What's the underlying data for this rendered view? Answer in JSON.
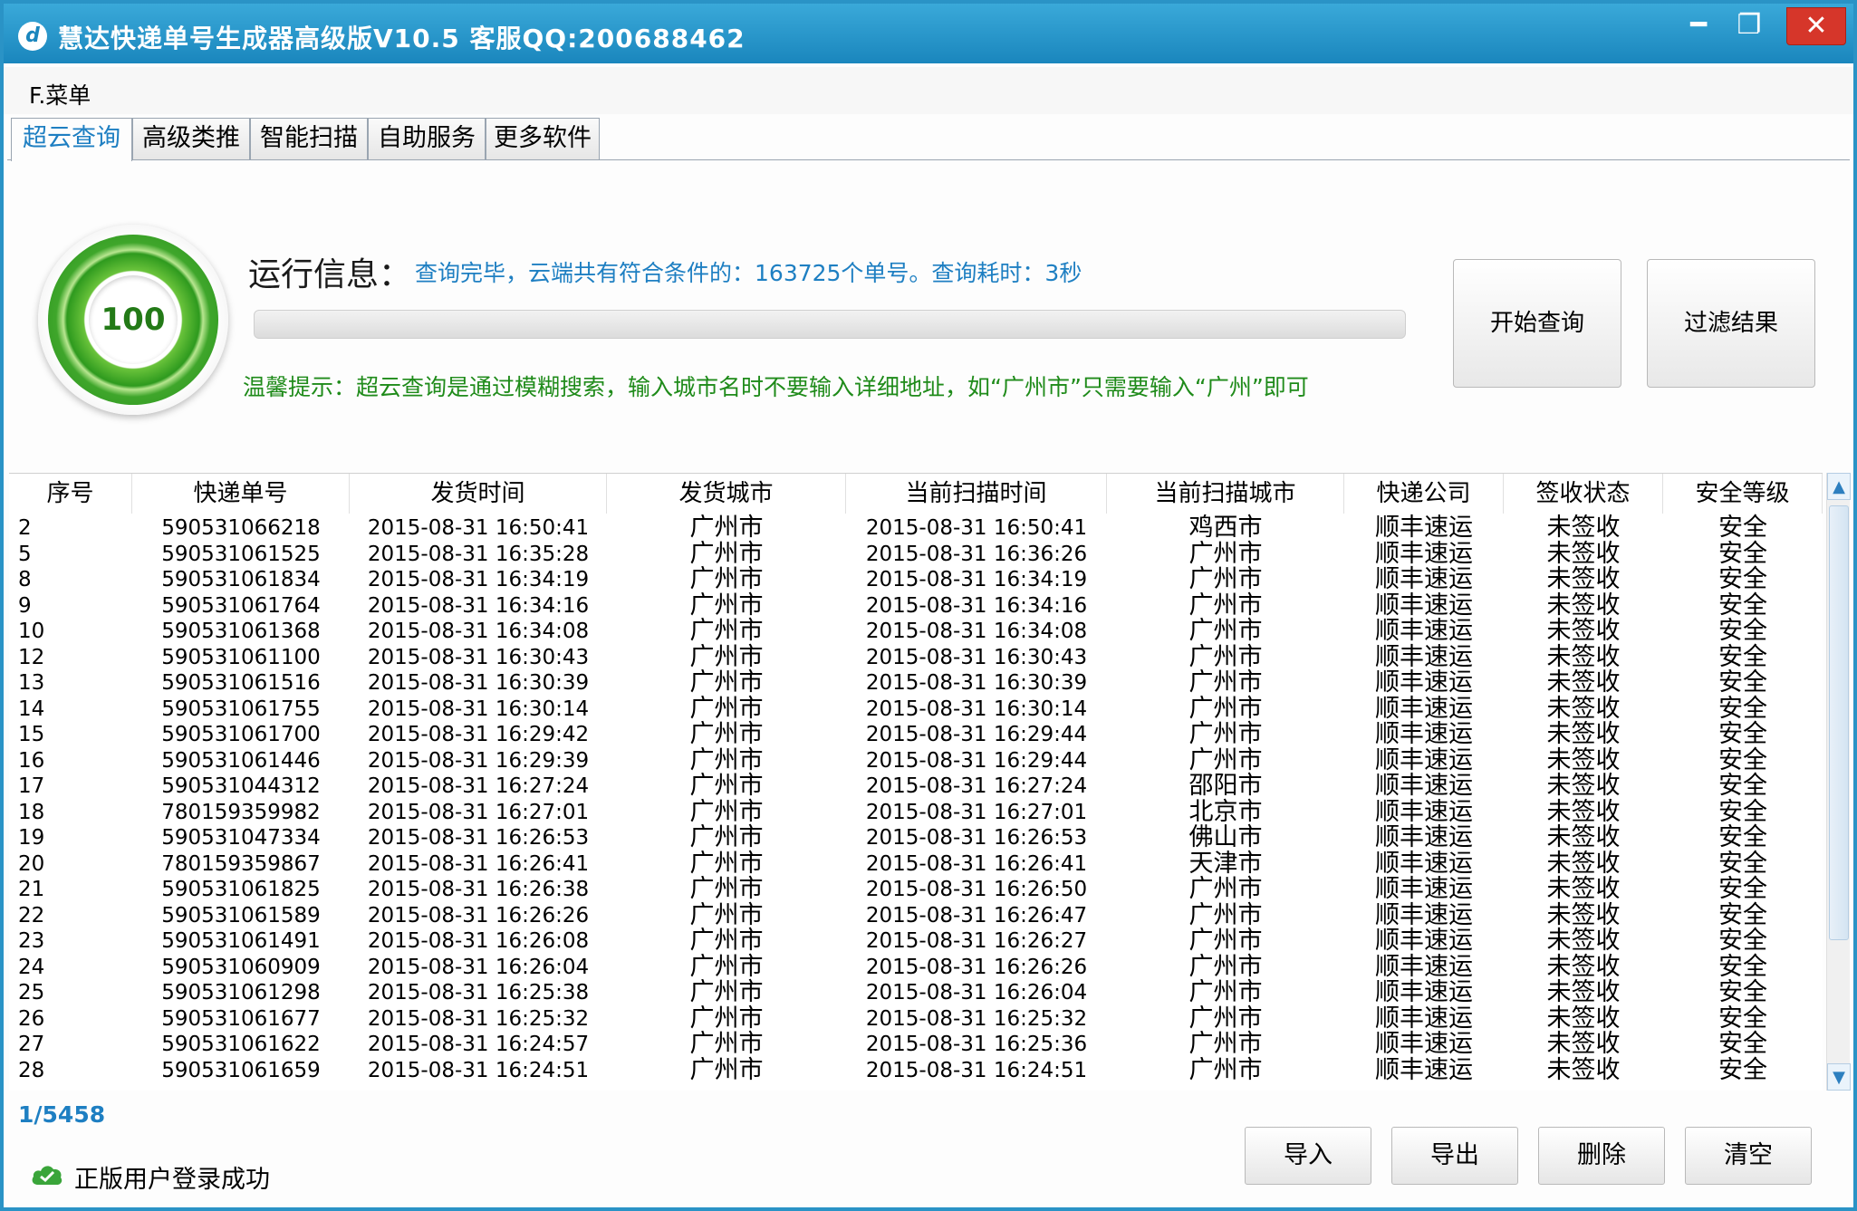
{
  "window": {
    "title": "慧达快递单号生成器高级版V10.5  客服QQ:200688462",
    "min_label": "━",
    "max_label": "❐",
    "close_label": "✕"
  },
  "menu": {
    "file_label": "F.菜单"
  },
  "tabs": [
    "超云查询",
    "高级类推",
    "智能扫描",
    "自助服务",
    "更多软件"
  ],
  "active_tab": "超云查询",
  "gauge": {
    "value": "100"
  },
  "run": {
    "label": "运行信息：",
    "message": "查询完毕，云端共有符合条件的：163725个单号。查询耗时：3秒",
    "progress_fraction": 0
  },
  "tip": "温馨提示：超云查询是通过模糊搜索，输入城市名时不要输入详细地址，如“广州市”只需要输入“广州”即可",
  "buttons": {
    "start": "开始查询",
    "filter": "过滤结果",
    "import": "导入",
    "export": "导出",
    "delete": "删除",
    "clear": "清空"
  },
  "table": {
    "columns": [
      "序号",
      "快递单号",
      "发货时间",
      "发货城市",
      "当前扫描时间",
      "当前扫描城市",
      "快递公司",
      "签收状态",
      "安全等级"
    ],
    "rows": [
      [
        "2",
        "590531066218",
        "2015-08-31  16:50:41",
        "广州市",
        "2015-08-31  16:50:41",
        "鸡西市",
        "顺丰速运",
        "未签收",
        "安全"
      ],
      [
        "5",
        "590531061525",
        "2015-08-31  16:35:28",
        "广州市",
        "2015-08-31  16:36:26",
        "广州市",
        "顺丰速运",
        "未签收",
        "安全"
      ],
      [
        "8",
        "590531061834",
        "2015-08-31  16:34:19",
        "广州市",
        "2015-08-31  16:34:19",
        "广州市",
        "顺丰速运",
        "未签收",
        "安全"
      ],
      [
        "9",
        "590531061764",
        "2015-08-31  16:34:16",
        "广州市",
        "2015-08-31  16:34:16",
        "广州市",
        "顺丰速运",
        "未签收",
        "安全"
      ],
      [
        "10",
        "590531061368",
        "2015-08-31  16:34:08",
        "广州市",
        "2015-08-31  16:34:08",
        "广州市",
        "顺丰速运",
        "未签收",
        "安全"
      ],
      [
        "12",
        "590531061100",
        "2015-08-31  16:30:43",
        "广州市",
        "2015-08-31  16:30:43",
        "广州市",
        "顺丰速运",
        "未签收",
        "安全"
      ],
      [
        "13",
        "590531061516",
        "2015-08-31  16:30:39",
        "广州市",
        "2015-08-31  16:30:39",
        "广州市",
        "顺丰速运",
        "未签收",
        "安全"
      ],
      [
        "14",
        "590531061755",
        "2015-08-31  16:30:14",
        "广州市",
        "2015-08-31  16:30:14",
        "广州市",
        "顺丰速运",
        "未签收",
        "安全"
      ],
      [
        "15",
        "590531061700",
        "2015-08-31  16:29:42",
        "广州市",
        "2015-08-31  16:29:44",
        "广州市",
        "顺丰速运",
        "未签收",
        "安全"
      ],
      [
        "16",
        "590531061446",
        "2015-08-31  16:29:39",
        "广州市",
        "2015-08-31  16:29:44",
        "广州市",
        "顺丰速运",
        "未签收",
        "安全"
      ],
      [
        "17",
        "590531044312",
        "2015-08-31  16:27:24",
        "广州市",
        "2015-08-31  16:27:24",
        "邵阳市",
        "顺丰速运",
        "未签收",
        "安全"
      ],
      [
        "18",
        "780159359982",
        "2015-08-31  16:27:01",
        "广州市",
        "2015-08-31  16:27:01",
        "北京市",
        "顺丰速运",
        "未签收",
        "安全"
      ],
      [
        "19",
        "590531047334",
        "2015-08-31  16:26:53",
        "广州市",
        "2015-08-31  16:26:53",
        "佛山市",
        "顺丰速运",
        "未签收",
        "安全"
      ],
      [
        "20",
        "780159359867",
        "2015-08-31  16:26:41",
        "广州市",
        "2015-08-31  16:26:41",
        "天津市",
        "顺丰速运",
        "未签收",
        "安全"
      ],
      [
        "21",
        "590531061825",
        "2015-08-31  16:26:38",
        "广州市",
        "2015-08-31  16:26:50",
        "广州市",
        "顺丰速运",
        "未签收",
        "安全"
      ],
      [
        "22",
        "590531061589",
        "2015-08-31  16:26:26",
        "广州市",
        "2015-08-31  16:26:47",
        "广州市",
        "顺丰速运",
        "未签收",
        "安全"
      ],
      [
        "23",
        "590531061491",
        "2015-08-31  16:26:08",
        "广州市",
        "2015-08-31  16:26:27",
        "广州市",
        "顺丰速运",
        "未签收",
        "安全"
      ],
      [
        "24",
        "590531060909",
        "2015-08-31  16:26:04",
        "广州市",
        "2015-08-31  16:26:26",
        "广州市",
        "顺丰速运",
        "未签收",
        "安全"
      ],
      [
        "25",
        "590531061298",
        "2015-08-31  16:25:38",
        "广州市",
        "2015-08-31  16:26:04",
        "广州市",
        "顺丰速运",
        "未签收",
        "安全"
      ],
      [
        "26",
        "590531061677",
        "2015-08-31  16:25:32",
        "广州市",
        "2015-08-31  16:25:32",
        "广州市",
        "顺丰速运",
        "未签收",
        "安全"
      ],
      [
        "27",
        "590531061622",
        "2015-08-31  16:24:57",
        "广州市",
        "2015-08-31  16:25:36",
        "广州市",
        "顺丰速运",
        "未签收",
        "安全"
      ],
      [
        "28",
        "590531061659",
        "2015-08-31  16:24:51",
        "广州市",
        "2015-08-31  16:24:51",
        "广州市",
        "顺丰速运",
        "未签收",
        "安全"
      ]
    ]
  },
  "pager": "1/5458",
  "status": {
    "icon": "cloud-check-icon",
    "text": "正版用户登录成功"
  },
  "colors": {
    "titlebar": "#1a86bd",
    "accent_blue": "#1e7fc2",
    "tip_green": "#1f8b1a",
    "gauge_green": "#3fa62b"
  }
}
